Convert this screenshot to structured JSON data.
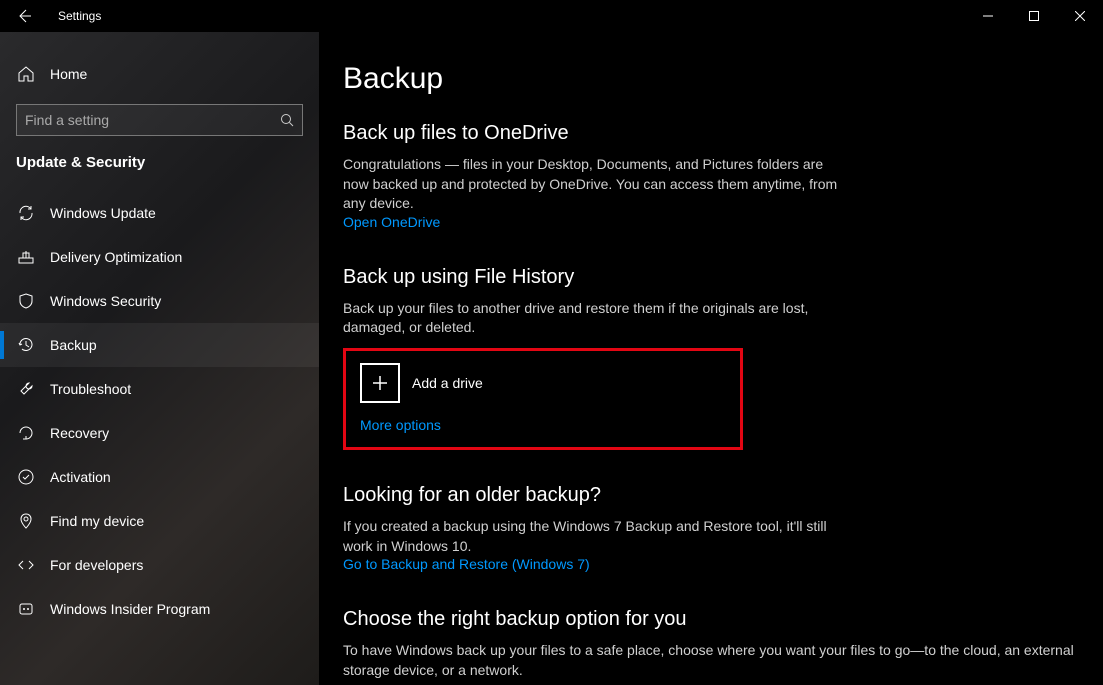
{
  "titlebar": {
    "title": "Settings"
  },
  "sidebar": {
    "home": "Home",
    "search_placeholder": "Find a setting",
    "category": "Update & Security",
    "items": [
      {
        "label": "Windows Update"
      },
      {
        "label": "Delivery Optimization"
      },
      {
        "label": "Windows Security"
      },
      {
        "label": "Backup"
      },
      {
        "label": "Troubleshoot"
      },
      {
        "label": "Recovery"
      },
      {
        "label": "Activation"
      },
      {
        "label": "Find my device"
      },
      {
        "label": "For developers"
      },
      {
        "label": "Windows Insider Program"
      }
    ]
  },
  "content": {
    "page_title": "Backup",
    "onedrive": {
      "heading": "Back up files to OneDrive",
      "text": "Congratulations — files in your Desktop, Documents, and Pictures folders are now backed up and protected by OneDrive. You can access them anytime, from any device.",
      "link": "Open OneDrive"
    },
    "filehistory": {
      "heading": "Back up using File History",
      "text": "Back up your files to another drive and restore them if the originals are lost, damaged, or deleted.",
      "add_drive": "Add a drive",
      "more_options": "More options"
    },
    "older": {
      "heading": "Looking for an older backup?",
      "text": "If you created a backup using the Windows 7 Backup and Restore tool, it'll still work in Windows 10.",
      "link": "Go to Backup and Restore (Windows 7)"
    },
    "choose": {
      "heading": "Choose the right backup option for you",
      "text": "To have Windows back up your files to a safe place, choose where you want your files to go—to the cloud, an external storage device, or a network."
    }
  }
}
